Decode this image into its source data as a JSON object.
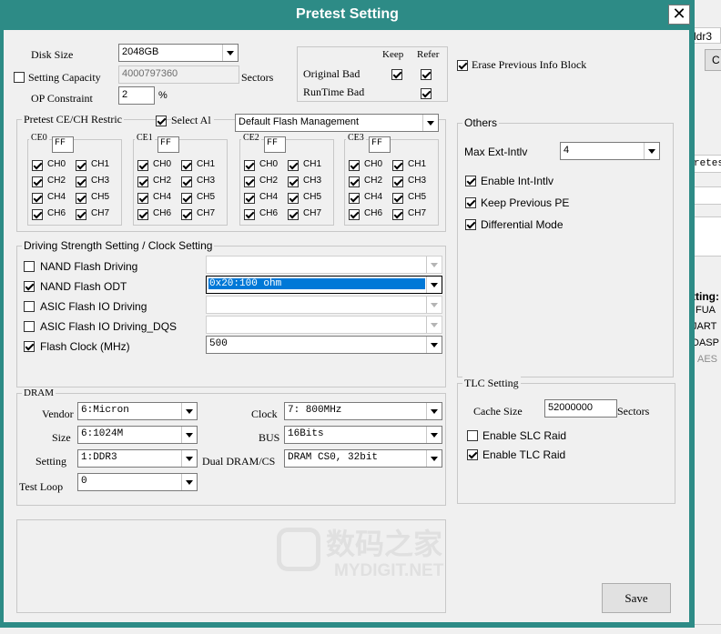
{
  "window": {
    "title": "Pretest Setting",
    "close_glyph": "✕"
  },
  "background_app": {
    "snippets": [
      "ldr3",
      "C",
      "retes",
      "tting:",
      "FUA",
      "JART",
      "DASP",
      "AES"
    ]
  },
  "top": {
    "disk_size_label": "Disk Size",
    "disk_size_value": "2048GB",
    "setting_capacity_label": "Setting Capacity",
    "setting_capacity_value": "4000797360",
    "sectors_label": "Sectors",
    "op_constraint_label": "OP Constraint",
    "op_constraint_value": "2",
    "percent_label": "%",
    "keep_label": "Keep",
    "refer_label": "Refer",
    "original_bad_label": "Original Bad",
    "runtime_bad_label": "RunTime Bad",
    "erase_label": "Erase Previous Info Block"
  },
  "pretest": {
    "legend": "Pretest CE/CH Restric",
    "select_all_label": "Select Al",
    "management_value": "Default Flash Management",
    "ce": [
      {
        "label": "CE0",
        "value": "FF"
      },
      {
        "label": "CE1",
        "value": "FF"
      },
      {
        "label": "CE2",
        "value": "FF"
      },
      {
        "label": "CE3",
        "value": "FF"
      }
    ],
    "channels": [
      "CH0",
      "CH1",
      "CH2",
      "CH3",
      "CH4",
      "CH5",
      "CH6",
      "CH7"
    ]
  },
  "driving": {
    "legend": "Driving Strength Setting / Clock Setting",
    "rows": [
      {
        "label": "NAND Flash Driving",
        "value": ""
      },
      {
        "label": "NAND Flash ODT",
        "value": "0x20:100 ohm"
      },
      {
        "label": "ASIC Flash IO Driving",
        "value": ""
      },
      {
        "label": "ASIC Flash IO Driving_DQS",
        "value": ""
      },
      {
        "label": "Flash Clock (MHz)",
        "value": "500"
      }
    ]
  },
  "dram": {
    "legend": "DRAM",
    "vendor_label": "Vendor",
    "vendor_value": "6:Micron",
    "size_label": "Size",
    "size_value": "6:1024M",
    "setting_label": "Setting",
    "setting_value": "1:DDR3",
    "test_loop_label": "Test Loop",
    "test_loop_value": "0",
    "clock_label": "Clock",
    "clock_value": "7: 800MHz",
    "bus_label": "BUS",
    "bus_value": "16Bits",
    "dual_label": "Dual DRAM/CS",
    "dual_value": "DRAM CS0, 32bit"
  },
  "others": {
    "legend": "Others",
    "max_ext_label": "Max Ext-Intlv",
    "max_ext_value": "4",
    "enable_int_label": "Enable Int-Intlv",
    "keep_prev_label": "Keep Previous PE",
    "diff_mode_label": "Differential Mode"
  },
  "tlc": {
    "legend": "TLC Setting",
    "cache_size_label": "Cache Size",
    "cache_size_value": "52000000",
    "sectors_label": "Sectors",
    "slc_label": "Enable SLC Raid",
    "tlc_label": "Enable TLC Raid"
  },
  "save_label": "Save",
  "watermark": {
    "line1": "数码之家",
    "line2": "MYDIGIT.NET"
  },
  "colors": {
    "titlebar": "#2d8b86",
    "selection": "#0078d7"
  }
}
